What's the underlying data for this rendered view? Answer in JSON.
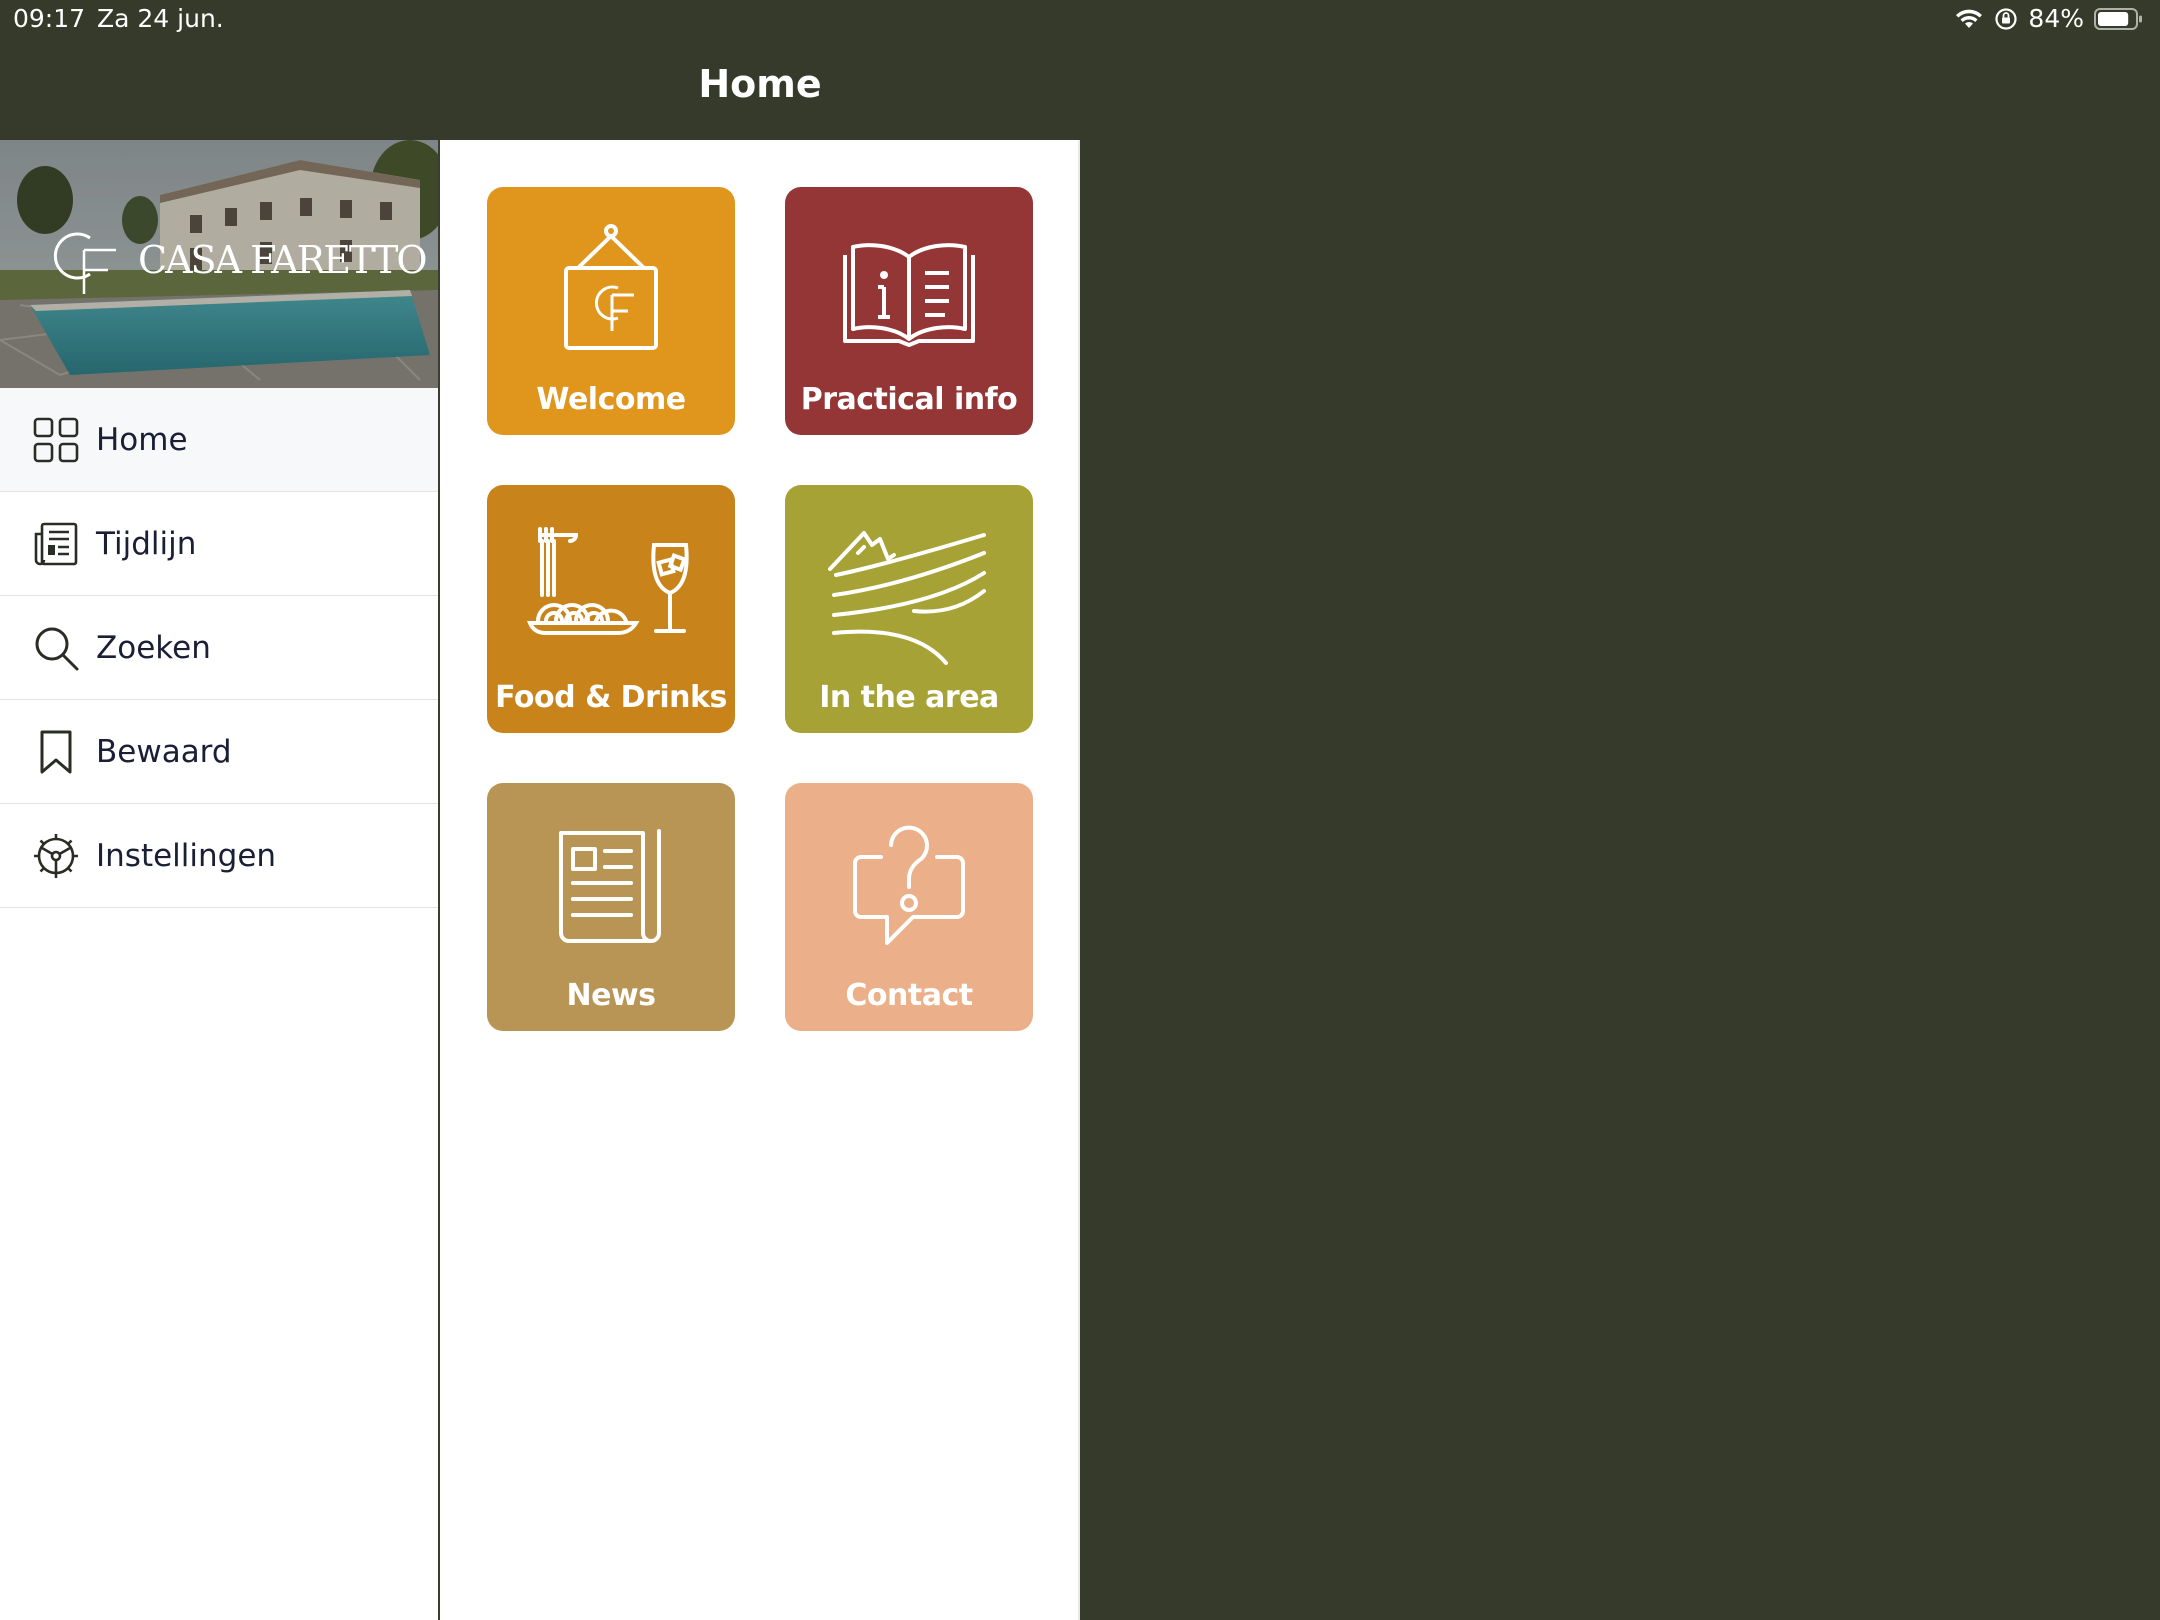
{
  "status_bar": {
    "time": "09:17",
    "date": "Za 24 jun.",
    "battery": "84%",
    "battery_level": 0.84
  },
  "nav": {
    "title": "Home"
  },
  "sidebar": {
    "brand": "CASA FARETTO",
    "monogram": "CF",
    "items": [
      {
        "label": "Home",
        "icon": "grid-icon",
        "active": true
      },
      {
        "label": "Tijdlijn",
        "icon": "newspaper-icon"
      },
      {
        "label": "Zoeken",
        "icon": "search-icon"
      },
      {
        "label": "Bewaard",
        "icon": "bookmark-icon"
      },
      {
        "label": "Instellingen",
        "icon": "gear-icon"
      }
    ]
  },
  "tiles": [
    {
      "label": "Welcome",
      "icon": "welcome-sign-icon",
      "color": "#e0951c"
    },
    {
      "label": "Practical info",
      "icon": "info-book-icon",
      "color": "#943636"
    },
    {
      "label": "Food & Drinks",
      "icon": "food-drinks-icon",
      "color": "#c8841a"
    },
    {
      "label": "In the area",
      "icon": "landscape-icon",
      "color": "#a6a236"
    },
    {
      "label": "News",
      "icon": "news-icon",
      "color": "#b89455"
    },
    {
      "label": "Contact",
      "icon": "contact-question-icon",
      "color": "#ebb08a"
    }
  ],
  "colors": {
    "header_background": "#363a2a",
    "active_menu_background": "#f7f8fa"
  }
}
